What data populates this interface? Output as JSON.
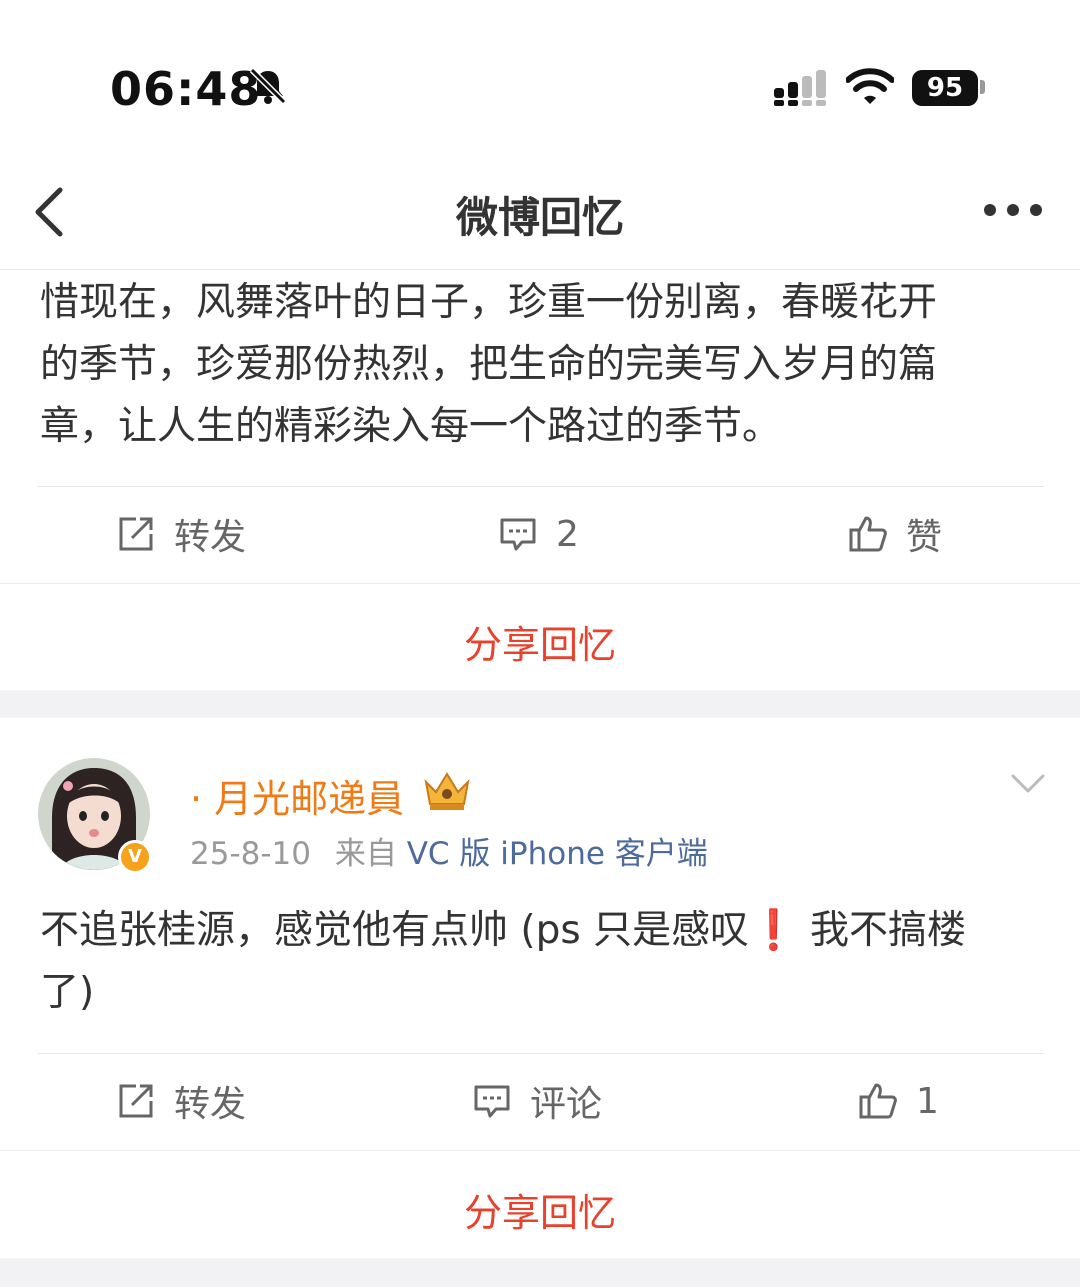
{
  "status_bar": {
    "time": "06:48",
    "battery": "95",
    "icons": [
      "bell-slash-icon",
      "signal-icon",
      "wifi-icon",
      "battery-icon"
    ]
  },
  "nav": {
    "title": "微博回忆",
    "back_icon": "chevron-left-icon",
    "more_icon": "more-dots-icon"
  },
  "post1": {
    "text_lines": [
      "惜现在，风舞落叶的日子，珍重一份别离，春暖花开",
      "的季节，珍爱那份热烈，把生命的完美写入岁月的篇",
      "章，让人生的精彩染入每一个路过的季节。"
    ],
    "actions": {
      "repost": "转发",
      "comment": "2",
      "like": "赞"
    },
    "share": "分享回忆"
  },
  "post2": {
    "username": "· 月光邮递員",
    "date": "25-8-10",
    "source_prefix": "来自",
    "source": "VC 版 iPhone 客户端",
    "verified": "V",
    "text_before_mark": "不追张桂源，感觉他有点帅 (ps 只是感叹",
    "mark": "❗",
    "text_after_mark": " 我不搞楼",
    "text_line2": "了)",
    "actions": {
      "repost": "转发",
      "comment": "评论",
      "like": "1"
    },
    "share": "分享回忆"
  },
  "colors": {
    "accent_red": "#e8412c",
    "username_orange": "#f07b16",
    "source_blue": "#4d6a9c",
    "section_gap": "#f2f2f4"
  }
}
